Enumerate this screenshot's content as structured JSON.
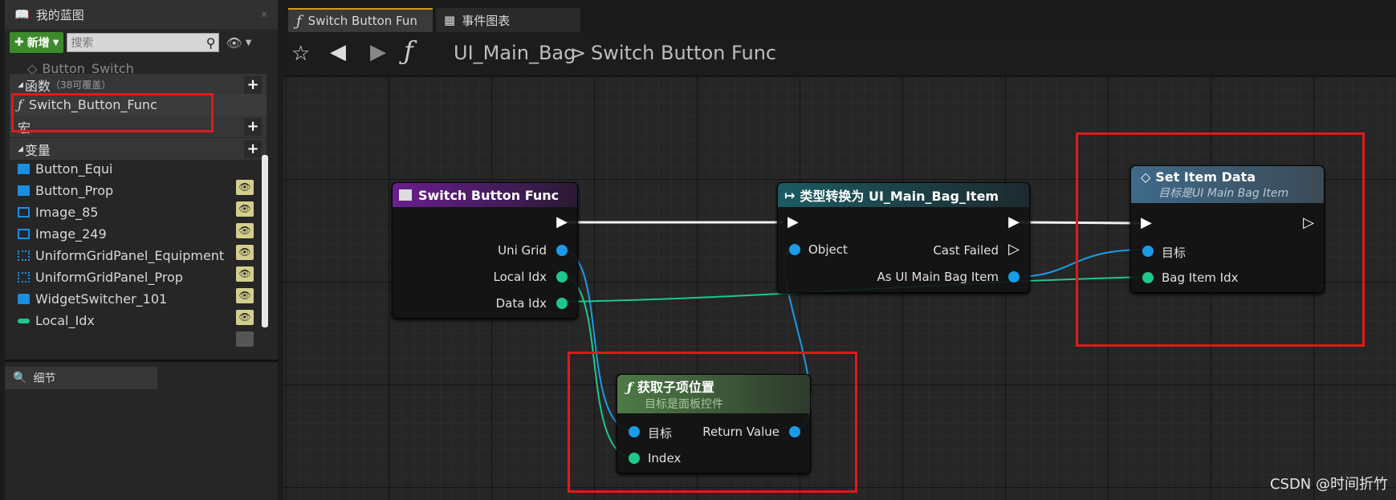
{
  "left_panel": {
    "tab_title": "我的蓝图",
    "new_button": "新增",
    "search_placeholder": "搜索",
    "partial_item": "Button_Switch",
    "functions_section": "函数",
    "functions_count": "（38可覆盖）",
    "function_item": "Switch_Button_Func",
    "macros_section": "宏",
    "variables_section": "变量",
    "variables": [
      {
        "name": "Button_Equi",
        "color": "#1a8ee0"
      },
      {
        "name": "Button_Prop",
        "color": "#1a8ee0"
      },
      {
        "name": "Image_85",
        "color": "#1a8ee0"
      },
      {
        "name": "Image_249",
        "color": "#1a8ee0"
      },
      {
        "name": "UniformGridPanel_Equipment",
        "color": "#1a8ee0"
      },
      {
        "name": "UniformGridPanel_Prop",
        "color": "#1a8ee0"
      },
      {
        "name": "WidgetSwitcher_101",
        "color": "#1a8ee0"
      },
      {
        "name": "Local_Idx",
        "color": "#1ec88a"
      }
    ],
    "details_tab": "细节"
  },
  "editor": {
    "tabs": [
      {
        "label": "Switch Button Fun",
        "icon": "function-icon",
        "active": true
      },
      {
        "label": "事件图表",
        "icon": "event-graph-icon",
        "active": false
      }
    ],
    "breadcrumb": {
      "root": "UI_Main_Bag",
      "separator": ">",
      "current": "Switch Button Func"
    }
  },
  "nodes": {
    "entry": {
      "title": "Switch Button Func",
      "pins": [
        "Uni Grid",
        "Local Idx",
        "Data Idx"
      ]
    },
    "cast": {
      "title": "类型转换为 UI_Main_Bag_Item",
      "in_pin": "Object",
      "failed_pin": "Cast Failed",
      "out_pin": "As UI Main Bag Item"
    },
    "set_item": {
      "title": "Set Item Data",
      "subtitle": "目标是UI Main Bag Item",
      "pins": [
        "目标",
        "Bag Item Idx"
      ]
    },
    "get_child": {
      "title": "获取子项位置",
      "subtitle": "目标是面板控件",
      "pins": [
        "目标",
        "Index"
      ],
      "out_pin": "Return Value"
    }
  },
  "colors": {
    "object_pin": "#1a9ce8",
    "int_pin": "#1ec88a",
    "highlight": "#e01a1a"
  },
  "watermark": "CSDN @时间折竹"
}
